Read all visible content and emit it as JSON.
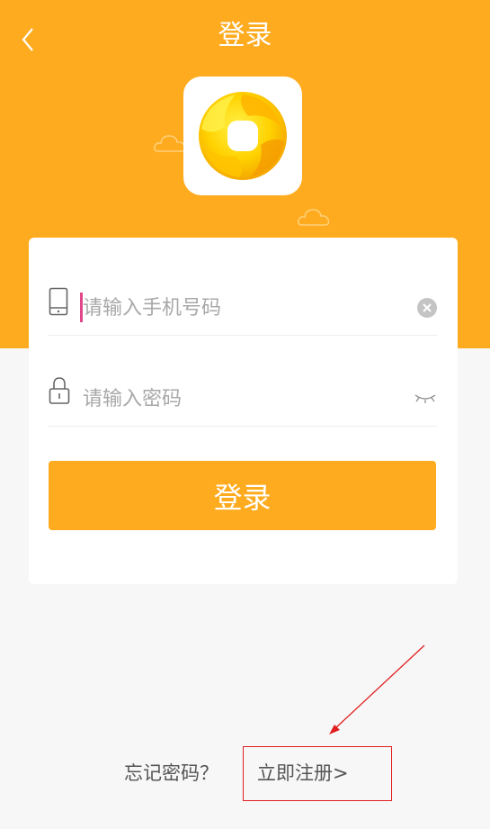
{
  "header": {
    "title": "登录",
    "back_icon": "chevron-left-icon",
    "background_color": "#ffab1f"
  },
  "logo": {
    "icon": "app-logo-icon"
  },
  "form": {
    "phone": {
      "icon": "phone-icon",
      "placeholder": "请输入手机号码",
      "value": "",
      "clear_icon": "clear-circle-icon"
    },
    "password": {
      "icon": "lock-icon",
      "placeholder": "请输入密码",
      "value": "",
      "toggle_icon": "eye-closed-icon"
    },
    "submit_label": "登录"
  },
  "footer": {
    "forgot_label": "忘记密码？",
    "register_label": "立即注册>"
  },
  "annotation": {
    "color": "#e02020"
  }
}
